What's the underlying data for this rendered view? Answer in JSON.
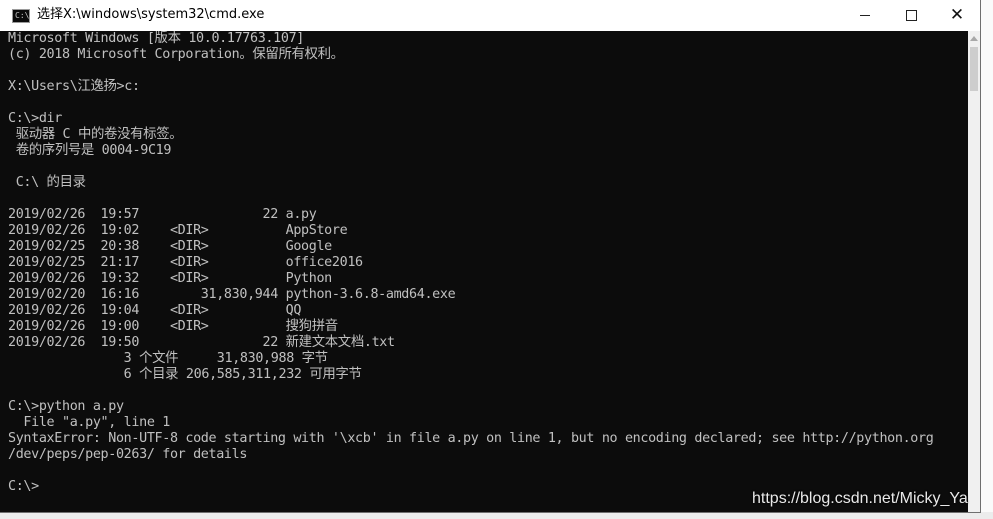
{
  "window": {
    "title": "选择X:\\windows\\system32\\cmd.exe",
    "icon_label": "C:\\",
    "minimize_symbol": "minimize-icon",
    "maximize_symbol": "maximize-icon",
    "close_symbol": "✕"
  },
  "console": {
    "lines": [
      "Microsoft Windows [版本 10.0.17763.107]",
      "(c) 2018 Microsoft Corporation。保留所有权利。",
      "",
      "X:\\Users\\江逸扬>c:",
      "",
      "C:\\>dir",
      " 驱动器 C 中的卷没有标签。",
      " 卷的序列号是 0004-9C19",
      "",
      " C:\\ 的目录",
      "",
      "2019/02/26  19:57                22 a.py",
      "2019/02/26  19:02    <DIR>          AppStore",
      "2019/02/25  20:38    <DIR>          Google",
      "2019/02/25  21:17    <DIR>          office2016",
      "2019/02/26  19:32    <DIR>          Python",
      "2019/02/20  16:16        31,830,944 python-3.6.8-amd64.exe",
      "2019/02/26  19:04    <DIR>          QQ",
      "2019/02/26  19:00    <DIR>          搜狗拼音",
      "2019/02/26  19:50                22 新建文本文档.txt",
      "               3 个文件     31,830,988 字节",
      "               6 个目录 206,585,311,232 可用字节",
      "",
      "C:\\>python a.py",
      "  File \"a.py\", line 1",
      "SyntaxError: Non-UTF-8 code starting with '\\xcb' in file a.py on line 1, but no encoding declared; see http://python.org",
      "/dev/peps/pep-0263/ for details",
      "",
      "C:\\>"
    ]
  },
  "watermark": "https://blog.csdn.net/Micky_Ya",
  "colors": {
    "console_bg": "#0c0c0c",
    "console_text": "#c0c0c0",
    "titlebar_bg": "#ffffff"
  }
}
